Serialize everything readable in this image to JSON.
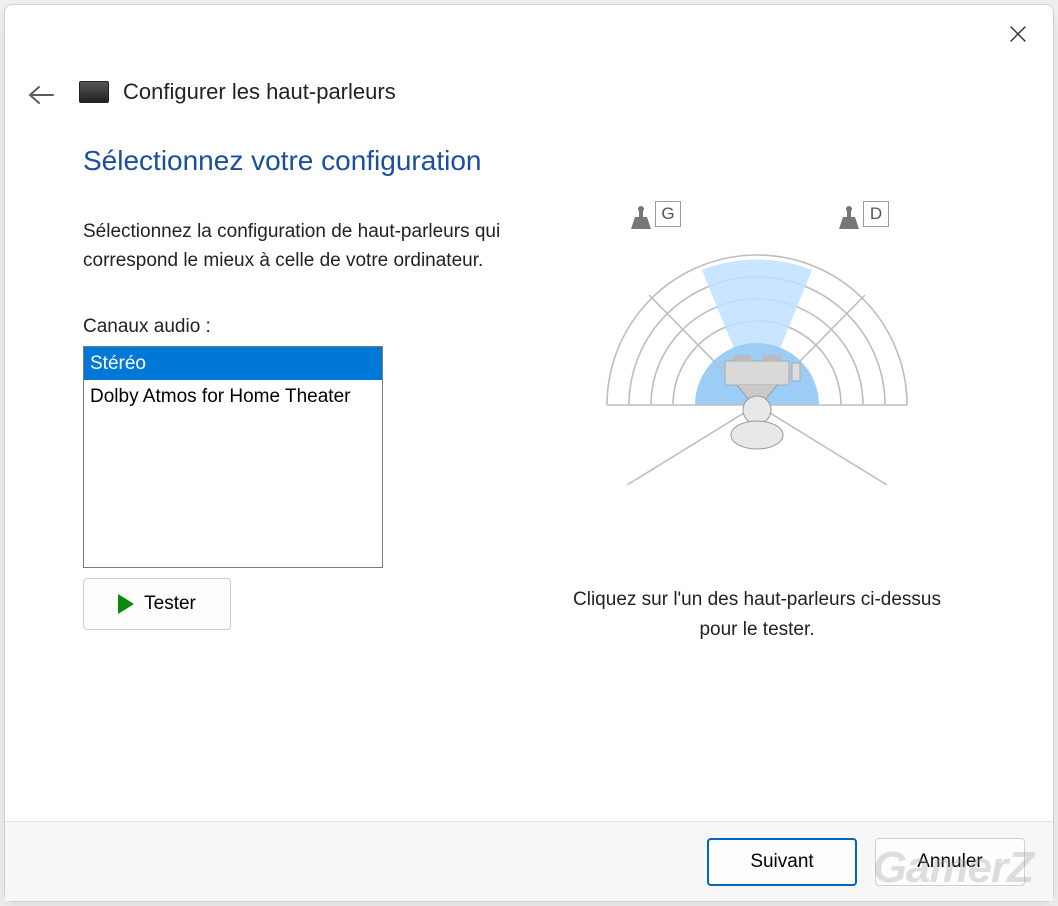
{
  "header": {
    "title": "Configurer les haut-parleurs"
  },
  "main": {
    "heading": "Sélectionnez votre configuration",
    "description": "Sélectionnez la configuration de haut-parleurs qui correspond le mieux à celle de votre ordinateur.",
    "channels_label": "Canaux audio :",
    "channels": [
      {
        "label": "Stéréo",
        "selected": true
      },
      {
        "label": "Dolby Atmos for Home Theater",
        "selected": false
      }
    ],
    "test_button": "Tester"
  },
  "diagram": {
    "left_label": "G",
    "right_label": "D",
    "hint": "Cliquez sur l'un des haut-parleurs ci-dessus pour le tester."
  },
  "footer": {
    "next": "Suivant",
    "cancel": "Annuler"
  },
  "watermark": "GamerZ"
}
